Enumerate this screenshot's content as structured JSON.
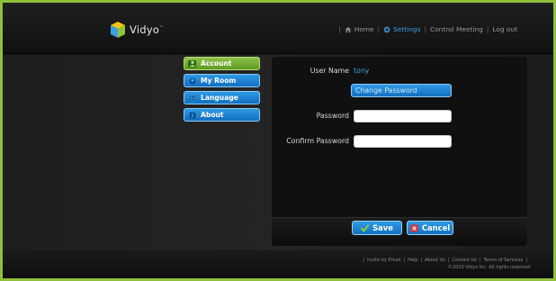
{
  "brand": {
    "name": "Vidyo",
    "tm": "™"
  },
  "topnav": {
    "home": "Home",
    "settings": "Settings",
    "control_meeting": "Control Meeting",
    "logout": "Log out"
  },
  "sidebar": {
    "items": [
      {
        "label": "Account",
        "state": "active"
      },
      {
        "label": "My Room",
        "state": "normal"
      },
      {
        "label": "Language",
        "state": "normal"
      },
      {
        "label": "About",
        "state": "normal"
      }
    ]
  },
  "account": {
    "username_label": "User Name",
    "username_value": "tony",
    "change_password_label": "Change Password",
    "password_label": "Password",
    "password_value": "",
    "confirm_label": "Confirm Password",
    "confirm_value": ""
  },
  "actions": {
    "save": "Save",
    "cancel": "Cancel"
  },
  "footer": {
    "links": [
      "Invite by Email",
      "Help",
      "About Us",
      "Contact Us",
      "Terms of Services"
    ],
    "copyright": "©2010 Vidyo Inc. All rights reserved"
  },
  "colors": {
    "accent_green": "#8fc03c",
    "accent_blue": "#3fa3e6",
    "button_blue": "#1a82d2",
    "cancel_red": "#e03030",
    "save_check": "#8fd23a"
  }
}
